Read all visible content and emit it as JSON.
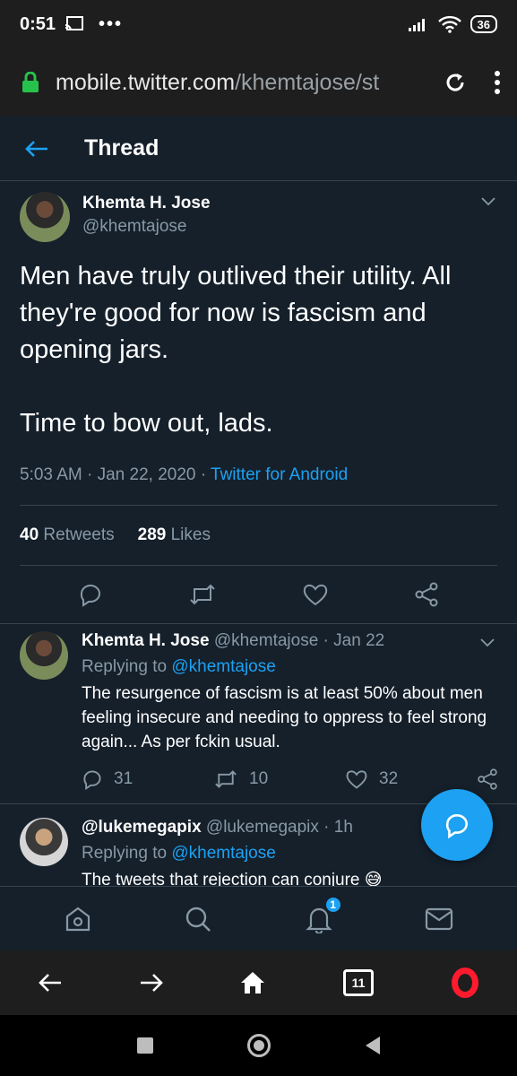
{
  "status_bar": {
    "time": "0:51",
    "battery": "36",
    "dots": "•••"
  },
  "browser": {
    "url_host": "mobile.twitter.com",
    "url_path": "/khemtajose/st"
  },
  "header": {
    "title": "Thread"
  },
  "main_tweet": {
    "author_name": "Khemta H. Jose",
    "author_handle": "@khemtajose",
    "text": "Men have truly outlived their utility. All they're good for now is fascism and opening jars.\n\nTime to bow out, lads.",
    "time": "5:03 AM · Jan 22, 2020 · ",
    "source": "Twitter for Android",
    "retweets_count": "40",
    "retweets_label": "Retweets",
    "likes_count": "289",
    "likes_label": "Likes"
  },
  "replies": [
    {
      "author_name": "Khemta H. Jose",
      "author_handle": "@khemtajose",
      "date": " · Jan 22",
      "replying_label": "Replying to ",
      "replying_to": "@khemtajose",
      "text": "The resurgence of fascism is at least 50% about men feeling insecure and needing to oppress to feel strong again... As per fckin usual.",
      "reply_count": "31",
      "retweet_count": "10",
      "like_count": "32"
    },
    {
      "author_name": "@lukemegapix",
      "author_handle": "@lukemegapix",
      "date": " · 1h",
      "replying_label": "Replying to ",
      "replying_to": "@khemtajose",
      "text": "The tweets that rejection can conjure 😅"
    }
  ],
  "tabbar": {
    "notification_badge": "1"
  },
  "browser_nav": {
    "tab_count": "11"
  },
  "colors": {
    "background": "#15202b",
    "accent": "#1da1f2",
    "muted": "#8899a6",
    "divider": "#38444d"
  }
}
